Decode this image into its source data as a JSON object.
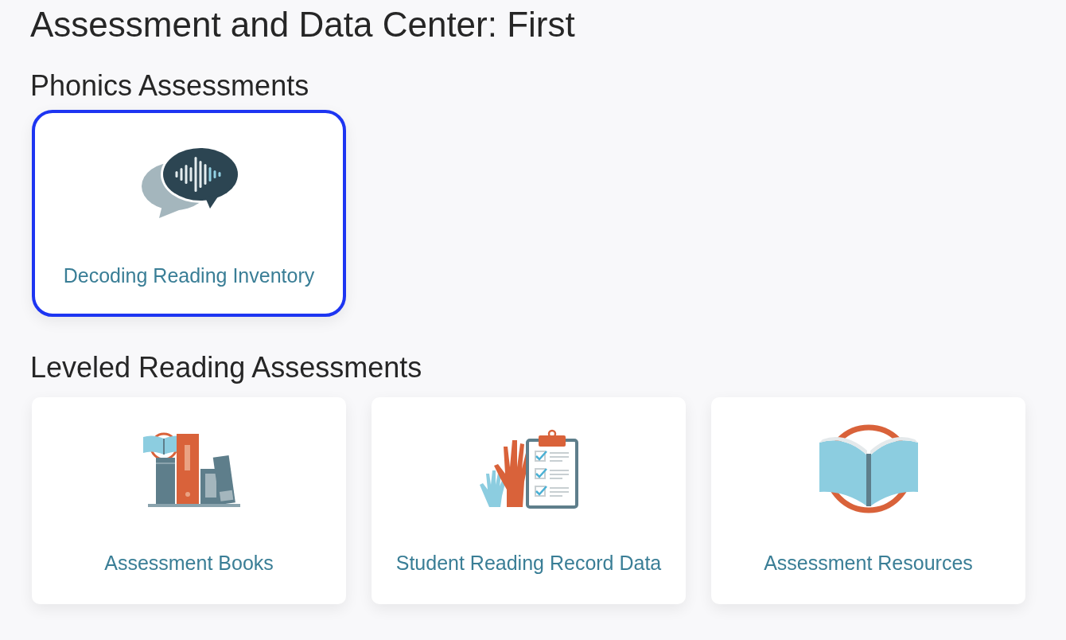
{
  "title": "Assessment and Data Center: First",
  "sections": [
    {
      "heading": "Phonics Assessments",
      "cards": [
        {
          "label": "Decoding Reading Inventory",
          "focused": true
        }
      ]
    },
    {
      "heading": "Leveled Reading Assessments",
      "cards": [
        {
          "label": "Assessment Books",
          "focused": false
        },
        {
          "label": "Student Reading Record Data",
          "focused": false
        },
        {
          "label": "Assessment Resources",
          "focused": false
        }
      ]
    }
  ]
}
